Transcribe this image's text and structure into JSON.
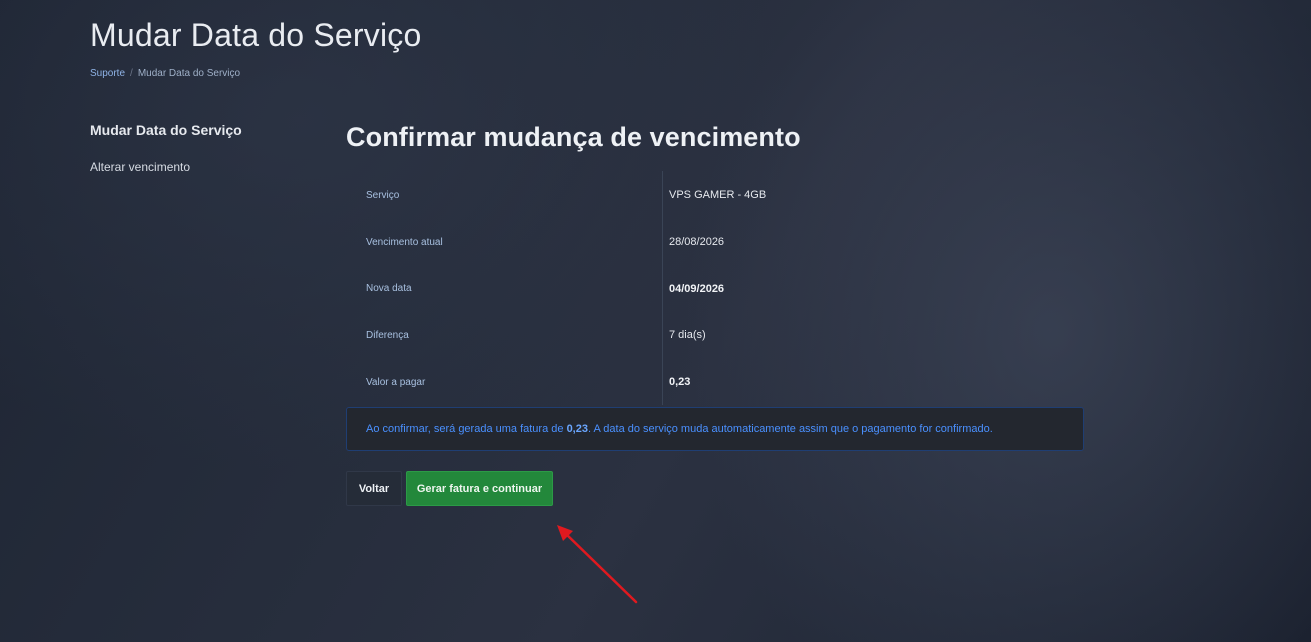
{
  "header": {
    "title": "Mudar Data do Serviço",
    "breadcrumb": {
      "home": "Suporte",
      "separator": "/",
      "current": "Mudar Data do Serviço"
    }
  },
  "sidebar": {
    "title": "Mudar Data do Serviço",
    "items": [
      {
        "label": "Alterar vencimento"
      }
    ]
  },
  "main": {
    "title": "Confirmar mudança de vencimento",
    "rows": [
      {
        "label": "Serviço",
        "value": "VPS GAMER - 4GB",
        "bold": false
      },
      {
        "label": "Vencimento atual",
        "value": "28/08/2026",
        "bold": false
      },
      {
        "label": "Nova data",
        "value": "04/09/2026",
        "bold": true
      },
      {
        "label": "Diferença",
        "value": "7 dia(s)",
        "bold": false
      },
      {
        "label": "Valor a pagar",
        "value": "0,23",
        "bold": true
      }
    ],
    "alert": {
      "prefix": "Ao confirmar, será gerada uma fatura de ",
      "amount": "0,23",
      "suffix": ". A data do serviço muda automaticamente assim que o pagamento for confirmado."
    },
    "buttons": {
      "back_label": "Voltar",
      "primary_label": "Gerar fatura e continuar"
    }
  },
  "annotation": {
    "arrow_color": "#e0191f",
    "arrow_icon": "red-arrow-annotation"
  }
}
